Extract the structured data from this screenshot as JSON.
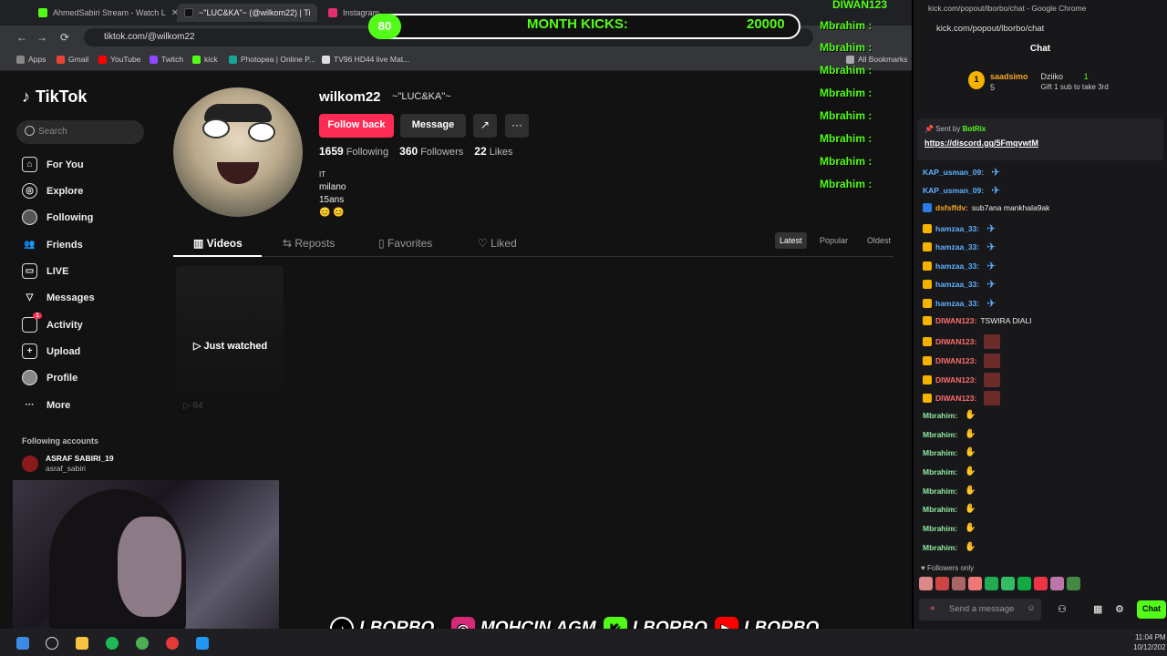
{
  "browser": {
    "tabs": [
      {
        "label": "AhmedSabiri Stream - Watch L",
        "color": "#53fc18"
      },
      {
        "label": "~\"LUC&KA\"~ (@wilkom22) | Ti",
        "color": "#000"
      },
      {
        "label": "Instagram",
        "color": "#e1306c"
      }
    ],
    "url": "tiktok.com/@wilkom22",
    "bookmarks": [
      "Apps",
      "Gmail",
      "YouTube",
      "Twitch",
      "kick",
      "Photopea | Online P...",
      "TV96 HD44 live Mat..."
    ],
    "all_bookmarks": "All Bookmarks"
  },
  "tiktok": {
    "logo": "TikTok",
    "search_placeholder": "Search",
    "nav": [
      "For You",
      "Explore",
      "Following",
      "Friends",
      "LIVE",
      "Messages",
      "Activity",
      "Upload",
      "Profile",
      "More"
    ],
    "activity_badge": "1",
    "following_accounts_header": "Following accounts",
    "account": {
      "name": "ASRAF SABIRI_19",
      "handle": "asraf_sabiri"
    },
    "profile": {
      "username": "wilkom22",
      "nickname": "~\"LUC&KA\"~",
      "follow_back": "Follow back",
      "message": "Message",
      "following_count": "1659",
      "following_label": "Following",
      "followers_count": "360",
      "followers_label": "Followers",
      "likes_count": "22",
      "likes_label": "Likes",
      "bio": [
        "ΙΤ",
        "milano",
        "15ans",
        "😊 😊"
      ]
    },
    "tabs": [
      "Videos",
      "Reposts",
      "Favorites",
      "Liked"
    ],
    "sort": [
      "Latest",
      "Popular",
      "Oldest"
    ],
    "video": {
      "overlay": "Just watched",
      "views": "64"
    }
  },
  "overlay": {
    "goal_number": "80",
    "goal_title": "MONTH KICKS:",
    "goal_value": "20000",
    "top_name": "DIWAN123",
    "names": [
      "Mbrahim :",
      "Mbrahim :",
      "Mbrahim :",
      "Mbrahim :",
      "Mbrahim :",
      "Mbrahim :",
      "Mbrahim :",
      "Mbrahim :"
    ],
    "socials": [
      "LBORBO_",
      "MOHCIN.AGM",
      "LBORBO",
      "LBORBO"
    ]
  },
  "chat": {
    "window_title": "kick.com/popout/lborbo/chat - Google Chrome",
    "url": "kick.com/popout/lborbo/chat",
    "header": "Chat",
    "gift": {
      "user": "saadsimo",
      "count": "5",
      "target": "Dziiko",
      "num": "1",
      "text": "Gift 1 sub to take 3rd"
    },
    "pinned": {
      "sent_by": "Sent by",
      "bot": "BotRix",
      "link": "https://discord.gg/5FmqvwtM"
    },
    "messages": [
      {
        "user": "KAP_usman_09:",
        "text": "",
        "color": "#5fb0ff",
        "emote": "blue"
      },
      {
        "user": "KAP_usman_09:",
        "text": "",
        "color": "#5fb0ff",
        "emote": "blue"
      },
      {
        "user": "dsfsffdv:",
        "text": "sub7ana mankhala9ak",
        "color": "#f5a623",
        "emote": ""
      },
      {
        "user": "hamzaa_33:",
        "text": "",
        "color": "#5fb0ff",
        "emote": "blue"
      },
      {
        "user": "hamzaa_33:",
        "text": "",
        "color": "#5fb0ff",
        "emote": "blue"
      },
      {
        "user": "hamzaa_33:",
        "text": "",
        "color": "#5fb0ff",
        "emote": "blue"
      },
      {
        "user": "hamzaa_33:",
        "text": "",
        "color": "#5fb0ff",
        "emote": "blue"
      },
      {
        "user": "hamzaa_33:",
        "text": "",
        "color": "#5fb0ff",
        "emote": "blue"
      },
      {
        "user": "DIWAN123:",
        "text": "TSWIRA DIALI",
        "color": "#ff6b6b",
        "emote": ""
      },
      {
        "user": "DIWAN123:",
        "text": "",
        "color": "#ff6b6b",
        "emote": "red"
      },
      {
        "user": "DIWAN123:",
        "text": "",
        "color": "#ff6b6b",
        "emote": "red"
      },
      {
        "user": "DIWAN123:",
        "text": "",
        "color": "#ff6b6b",
        "emote": "red"
      },
      {
        "user": "DIWAN123:",
        "text": "",
        "color": "#ff6b6b",
        "emote": "red"
      },
      {
        "user": "Mbrahim:",
        "text": "",
        "color": "#8ee6a0",
        "emote": "hand"
      },
      {
        "user": "Mbrahim:",
        "text": "",
        "color": "#8ee6a0",
        "emote": "hand"
      },
      {
        "user": "Mbrahim:",
        "text": "",
        "color": "#8ee6a0",
        "emote": "hand"
      },
      {
        "user": "Mbrahim:",
        "text": "",
        "color": "#8ee6a0",
        "emote": "hand"
      },
      {
        "user": "Mbrahim:",
        "text": "",
        "color": "#8ee6a0",
        "emote": "hand"
      },
      {
        "user": "Mbrahim:",
        "text": "",
        "color": "#8ee6a0",
        "emote": "hand"
      },
      {
        "user": "Mbrahim:",
        "text": "",
        "color": "#8ee6a0",
        "emote": "hand"
      },
      {
        "user": "Mbrahim:",
        "text": "",
        "color": "#8ee6a0",
        "emote": "hand"
      }
    ],
    "followers_only": "Followers only",
    "input_placeholder": "Send a message",
    "send_label": "Chat"
  },
  "taskbar": {
    "time": "11:04 PM",
    "date": "10/12/202"
  },
  "colors": {
    "accent_tiktok": "#fe2c55",
    "accent_kick": "#53fc18"
  }
}
